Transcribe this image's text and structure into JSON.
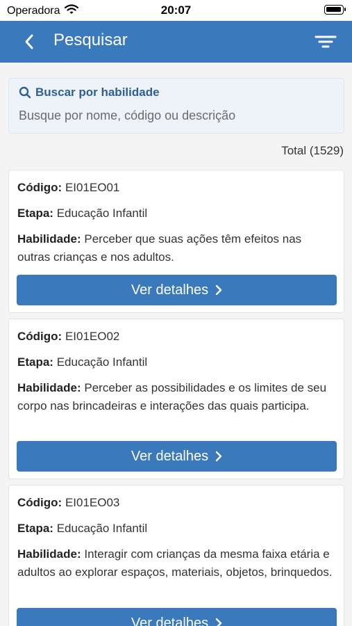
{
  "status_bar": {
    "carrier": "Operadora",
    "time": "20:07"
  },
  "navbar": {
    "title": "Pesquisar"
  },
  "search": {
    "label": "Buscar por habilidade",
    "placeholder": "Busque por nome, código ou descrição"
  },
  "total": "Total (1529)",
  "labels": {
    "codigo": "Código:",
    "etapa": "Etapa:",
    "habilidade": "Habilidade:",
    "button": "Ver detalhes"
  },
  "cards": [
    {
      "codigo": "EI01EO01",
      "etapa": "Educação Infantil",
      "habilidade": "Perceber que suas ações têm efeitos nas outras crianças e nos adultos."
    },
    {
      "codigo": "EI01EO02",
      "etapa": "Educação Infantil",
      "habilidade": "Perceber as possibilidades e os limites de seu corpo nas brincadeiras e interações das quais participa."
    },
    {
      "codigo": "EI01EO03",
      "etapa": "Educação Infantil",
      "habilidade": "Interagir com crianças da mesma faixa etária e adultos ao explorar espaços, materiais, objetos, brinquedos."
    }
  ]
}
